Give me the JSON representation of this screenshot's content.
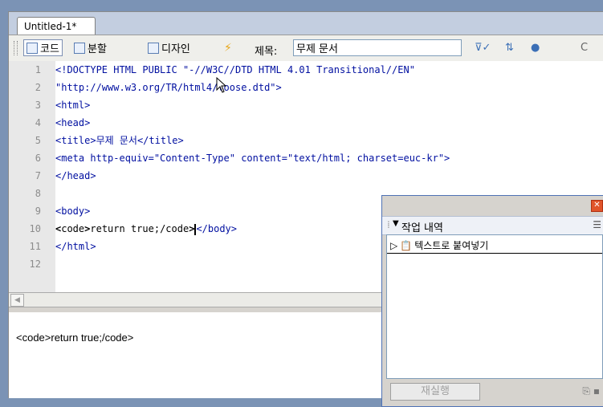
{
  "document_tab": {
    "label": "Untitled-1*"
  },
  "toolbar": {
    "code_label": "코드",
    "split_label": "분할",
    "design_label": "디자인",
    "title_label": "제목:",
    "title_value": "무제 문서",
    "icons": [
      "code-view-icon",
      "split-view-icon",
      "design-view-icon",
      "live-data-icon",
      "validate-icon",
      "file-management-icon",
      "browser-preview-icon",
      "refresh-icon"
    ]
  },
  "editor": {
    "lines": [
      {
        "num": "1",
        "code": "<!DOCTYPE HTML PUBLIC \"-//W3C//DTD HTML 4.01 Transitional//EN\""
      },
      {
        "num": "2",
        "code": "\"http://www.w3.org/TR/html4/loose.dtd\">"
      },
      {
        "num": "3",
        "code": "<html>"
      },
      {
        "num": "4",
        "code": "<head>"
      },
      {
        "num": "5",
        "code": "<title>무제 문서</title>"
      },
      {
        "num": "6",
        "code": "<meta http-equiv=\"Content-Type\" content=\"text/html; charset=euc-kr\">"
      },
      {
        "num": "7",
        "code": "</head>"
      },
      {
        "num": "8",
        "code": ""
      },
      {
        "num": "9",
        "code": "<body>"
      },
      {
        "num": "10",
        "ent1": "&lt;",
        "text1": "code",
        "ent2": "&gt;",
        "text2": "return true;/code",
        "ent3": "&gt;",
        "tag": "</body>"
      },
      {
        "num": "11",
        "code": "</html>"
      },
      {
        "num": "12",
        "code": ""
      }
    ]
  },
  "design_view": {
    "text": "<code>return true;/code>"
  },
  "history_panel": {
    "title": "작업 내역",
    "items": [
      {
        "label": "텍스트로 붙여넣기"
      }
    ],
    "replay_label": "재실행"
  },
  "colors": {
    "tag": "#000fa0",
    "gutter": "#e8e8e8",
    "panel_border": "#4f72b5"
  }
}
